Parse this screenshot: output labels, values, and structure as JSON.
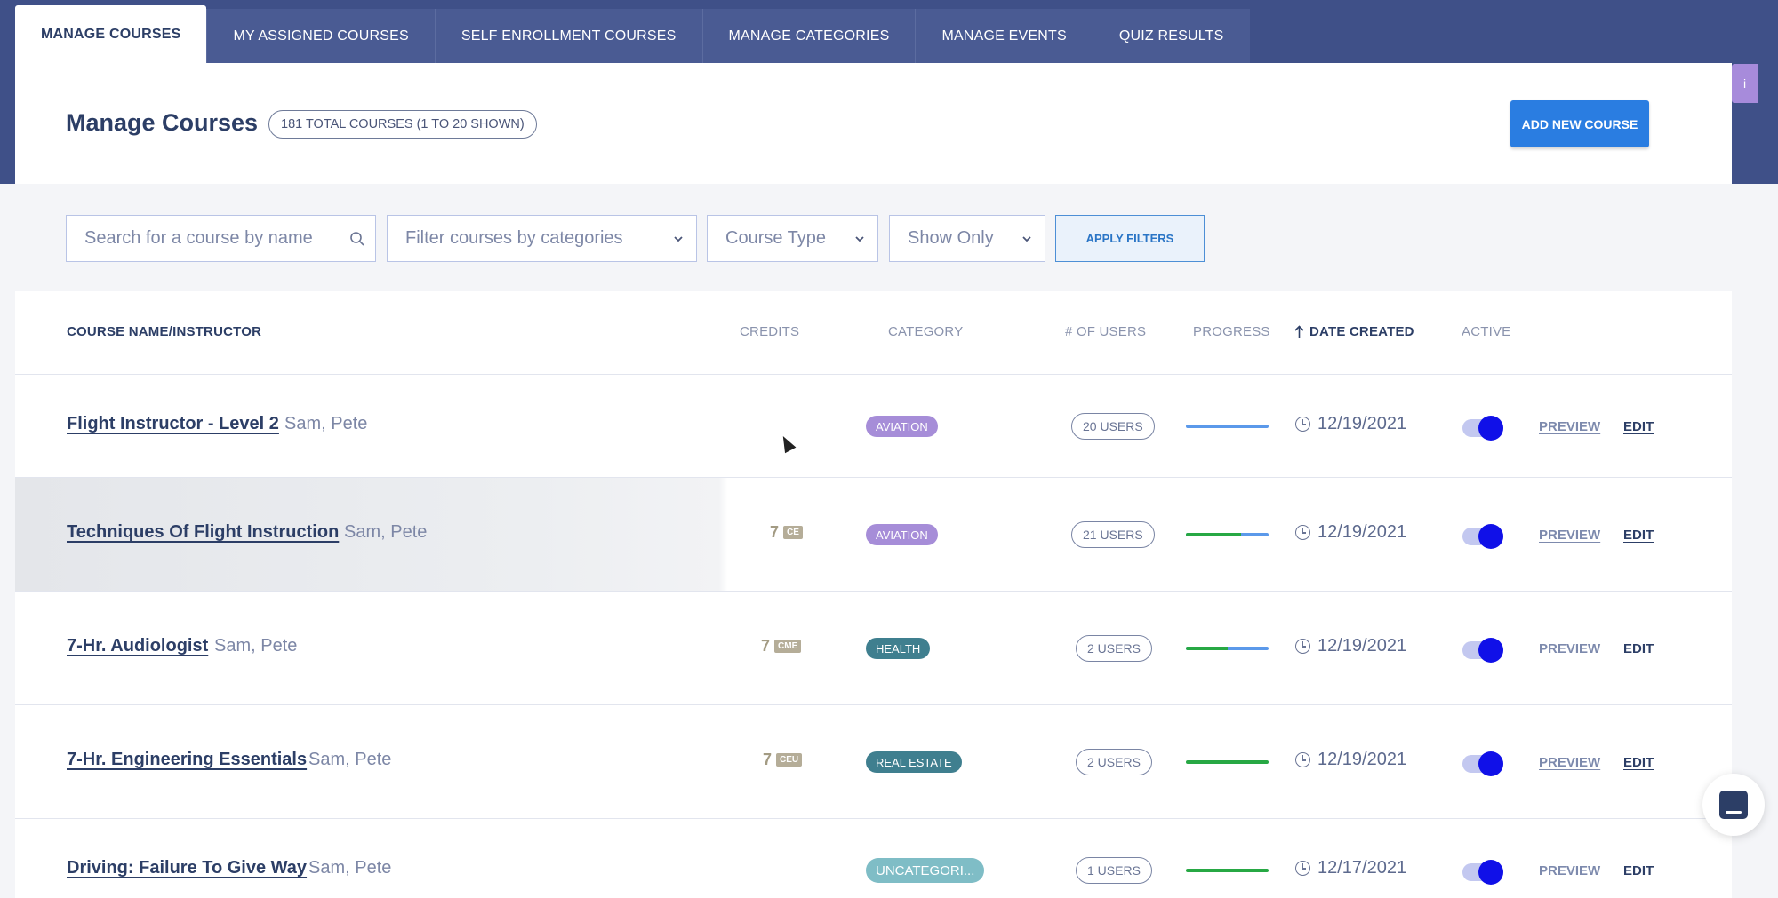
{
  "tabs": [
    {
      "label": "MANAGE COURSES",
      "active": true
    },
    {
      "label": "MY ASSIGNED COURSES",
      "active": false
    },
    {
      "label": "SELF ENROLLMENT COURSES",
      "active": false
    },
    {
      "label": "MANAGE CATEGORIES",
      "active": false
    },
    {
      "label": "MANAGE EVENTS",
      "active": false
    },
    {
      "label": "QUIZ RESULTS",
      "active": false
    }
  ],
  "header": {
    "title": "Manage Courses",
    "count_badge": "181 TOTAL COURSES (1 TO 20 SHOWN)",
    "add_button": "ADD NEW COURSE",
    "side_tag": "i"
  },
  "filters": {
    "search_placeholder": "Search for a course by name",
    "categories_placeholder": "Filter courses by categories",
    "course_type": "Course Type",
    "show_only": "Show Only",
    "apply_button": "APPLY FILTERS"
  },
  "columns": {
    "name": "COURSE NAME/INSTRUCTOR",
    "credits": "CREDITS",
    "category": "CATEGORY",
    "users": "# OF USERS",
    "progress": "PROGRESS",
    "date": "DATE CREATED",
    "active": "ACTIVE"
  },
  "row_actions": {
    "preview": "PREVIEW",
    "edit": "EDIT"
  },
  "courses": [
    {
      "name": "Flight Instructor - Level 2",
      "instructor": "Sam, Pete",
      "credits": "",
      "credit_type": "",
      "category": "AVIATION",
      "category_color": "#a68dd8",
      "users": "20 USERS",
      "progress_complete": 0.0,
      "date": "12/19/2021",
      "active": true
    },
    {
      "name": "Techniques Of Flight Instruction",
      "instructor": "Sam, Pete",
      "credits": "7",
      "credit_type": "CE",
      "category": "AVIATION",
      "category_color": "#a68dd8",
      "users": "21 USERS",
      "progress_complete": 0.67,
      "date": "12/19/2021",
      "active": true
    },
    {
      "name": "7-Hr. Audiologist",
      "instructor": "Sam, Pete",
      "credits": "7",
      "credit_type": "CME",
      "category": "HEALTH",
      "category_color": "#3f7f8f",
      "users": "2 USERS",
      "progress_complete": 0.5,
      "date": "12/19/2021",
      "active": true
    },
    {
      "name": "7-Hr. Engineering Essentials",
      "instructor": "Sam, Pete",
      "credits": "7",
      "credit_type": "CEU",
      "category": "REAL ESTATE",
      "category_color": "#3f7f8f",
      "users": "2 USERS",
      "progress_complete": 1.0,
      "date": "12/19/2021",
      "active": true
    },
    {
      "name": "Driving: Failure To Give Way",
      "instructor": "Sam, Pete",
      "credits": "",
      "credit_type": "",
      "category": "UNCATEGORI...",
      "category_color": "#7fbdc6",
      "users": "1 USERS",
      "progress_complete": 1.0,
      "date": "12/17/2021",
      "active": true
    }
  ]
}
